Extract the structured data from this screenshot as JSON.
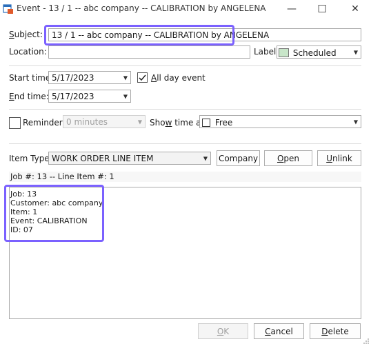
{
  "window": {
    "title": "Event - 13 / 1 -- abc company -- CALIBRATION by ANGELENA",
    "icon": "calendar-icon",
    "minimize_glyph": "—",
    "maximize_glyph": "☐",
    "close_glyph": "✕"
  },
  "form": {
    "subject_label_u": "S",
    "subject_label_rest": "ubject:",
    "subject_value": "13 / 1 -- abc company -- CALIBRATION by ANGELENA",
    "location_label": "Location:",
    "location_value": "",
    "label_label": "Label:",
    "label_value": "Scheduled",
    "label_color": "#c8e6c9",
    "start_label": "Start time:",
    "start_value": "5/17/2023",
    "allday_checked": true,
    "allday_label_u": "A",
    "allday_label_rest": "ll day event",
    "end_label_u": "E",
    "end_label_rest": "nd time:",
    "end_value": "5/17/2023",
    "reminder_checked": false,
    "reminder_label": "Reminder:",
    "reminder_value": "0 minutes",
    "showtime_label_pre": "Sho",
    "showtime_label_u": "w",
    "showtime_label_rest": " time as:",
    "showtime_value": "Free",
    "item_type_label": "Item Type:",
    "item_type_value": "WORK ORDER LINE ITEM",
    "company_button": "Company",
    "open_button_u": "O",
    "open_button_rest": "pen",
    "unlink_button_u": "U",
    "unlink_button_rest": "nlink",
    "job_line": "Job #: 13 -- Line Item #: 1",
    "details": [
      "Job:  13",
      "Customer:  abc company",
      "Item:  1",
      "Event:  CALIBRATION",
      "ID:  07"
    ]
  },
  "footer": {
    "ok_u": "O",
    "ok_rest": "K",
    "cancel_u": "C",
    "cancel_rest": "ancel",
    "delete_u": "D",
    "delete_rest": "elete"
  },
  "colors": {
    "highlight": "#7b61ff"
  }
}
